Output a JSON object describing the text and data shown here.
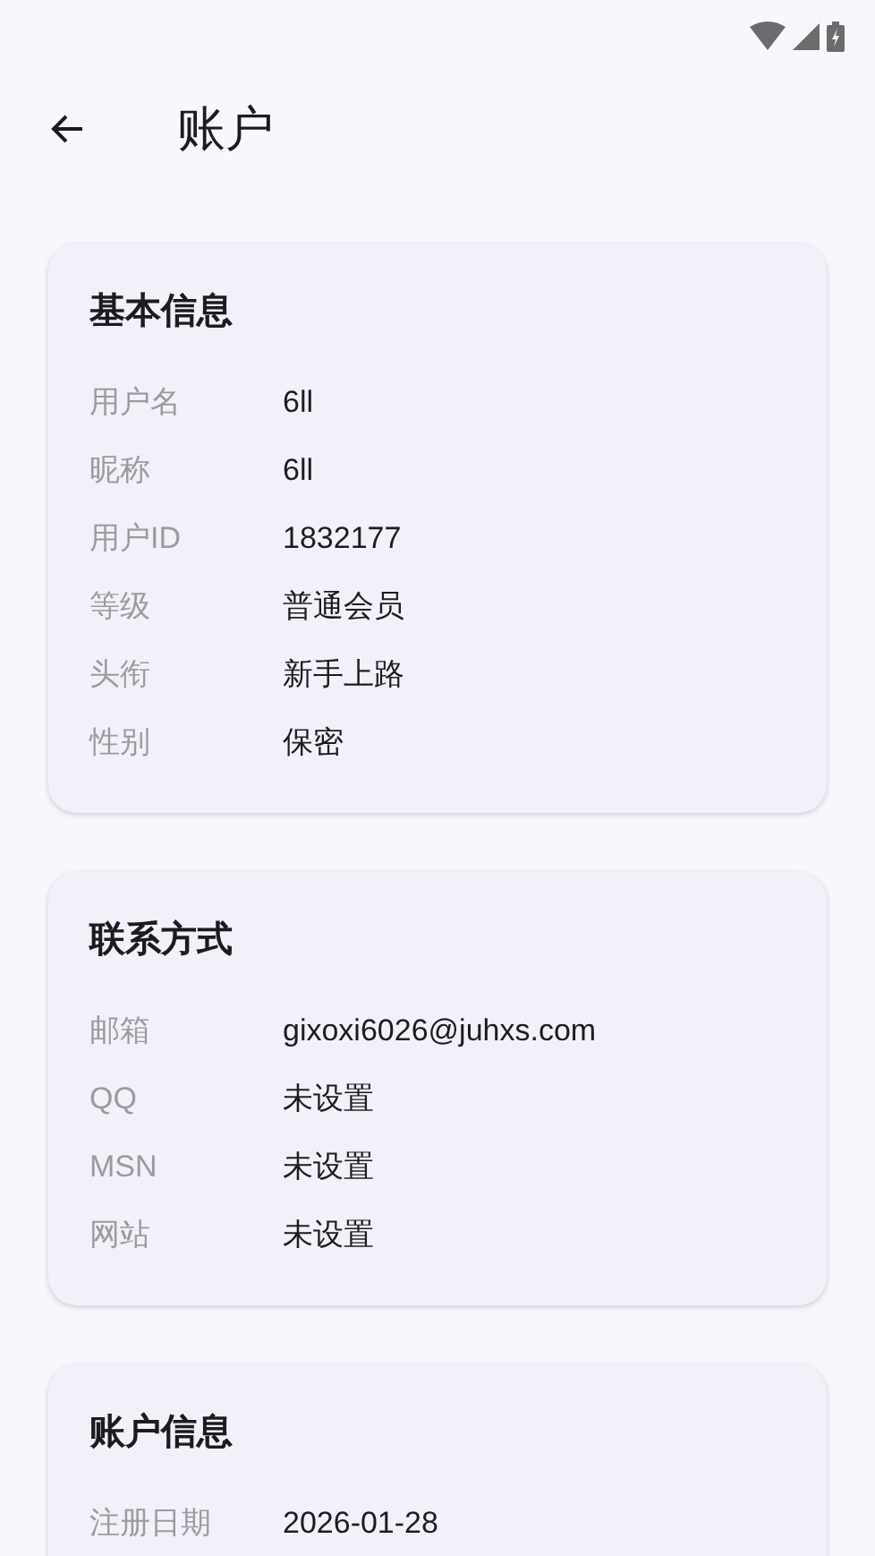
{
  "app_bar": {
    "title": "账户"
  },
  "sections": [
    {
      "title": "基本信息",
      "fields": [
        {
          "label": "用户名",
          "value": "6ll"
        },
        {
          "label": "昵称",
          "value": "6ll"
        },
        {
          "label": "用户ID",
          "value": "1832177"
        },
        {
          "label": "等级",
          "value": "普通会员"
        },
        {
          "label": "头衔",
          "value": "新手上路"
        },
        {
          "label": "性别",
          "value": "保密"
        }
      ]
    },
    {
      "title": "联系方式",
      "fields": [
        {
          "label": "邮箱",
          "value": "gixoxi6026@juhxs.com"
        },
        {
          "label": "QQ",
          "value": "未设置"
        },
        {
          "label": "MSN",
          "value": "未设置"
        },
        {
          "label": "网站",
          "value": "未设置"
        }
      ]
    },
    {
      "title": "账户信息",
      "fields": [
        {
          "label": "注册日期",
          "value": "2026-01-28"
        }
      ]
    }
  ]
}
